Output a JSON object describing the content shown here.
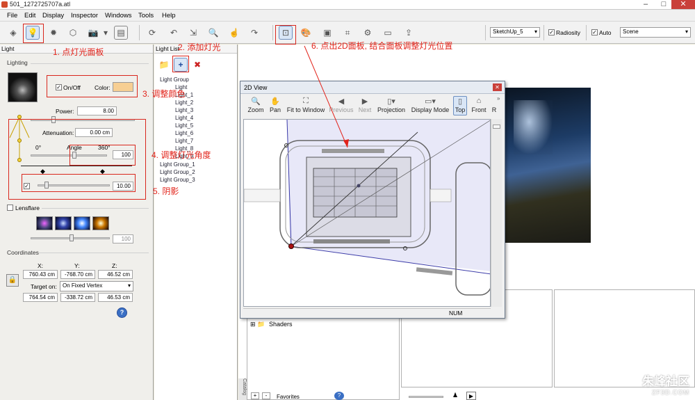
{
  "window": {
    "title": "501_1272725707a.atl"
  },
  "menu": [
    "File",
    "Edit",
    "Display",
    "Inspector",
    "Windows",
    "Tools",
    "Help"
  ],
  "toolbar": {
    "renderer_select": "SketchUp_5",
    "radiosity_label": "Radiosity",
    "auto_label": "Auto",
    "scene_select": "Scene"
  },
  "light_panel": {
    "title": "Light",
    "lighting_label": "Lighting",
    "onoff_label": "On/Off",
    "color_label": "Color:",
    "color_value": "#f7cf93",
    "power_label": "Power:",
    "power_value": "8.00",
    "attenuation_label": "Attenuation:",
    "attenuation_value": "0.00 cm",
    "angle_min": "0°",
    "angle_label": "Angle",
    "angle_max": "360°",
    "angle_value": "100",
    "shadow_value": "10.00",
    "lensflare_label": "Lensflare",
    "lensflare_value": "100",
    "coordinates_label": "Coordinates",
    "x_label": "X:",
    "y_label": "Y:",
    "z_label": "Z:",
    "x_value": "760.43 cm",
    "y_value": "-768.70 cm",
    "z_value": "46.52 cm",
    "target_label": "Target on:",
    "target_value": "On Fixed Vertex",
    "tx_value": "764.54 cm",
    "ty_value": "-338.72 cm",
    "tz_value": "46.53 cm"
  },
  "light_list": {
    "title": "Light List",
    "items": [
      "Light Group",
      "Light",
      "Light_1",
      "Light_2",
      "Light_3",
      "Light_4",
      "Light_5",
      "Light_6",
      "Light_7",
      "Light_8",
      "Light_9",
      "Light Group_1",
      "Light Group_2",
      "Light Group_3"
    ]
  },
  "view2d": {
    "title": "2D View",
    "tools": [
      "Zoom",
      "Pan",
      "Fit to Window",
      "Previous",
      "Next",
      "Projection",
      "Display Mode",
      "Top",
      "Front",
      "R"
    ],
    "status": "NUM"
  },
  "bottom": {
    "shaders_label": "Shaders",
    "favorites_label": "Favorites",
    "catalog_label": "Catalog"
  },
  "annotations": {
    "a1": "1. 点灯光面板",
    "a2": "2. 添加灯光",
    "a3": "3. 调整颜色",
    "a4": "4. 调整灯光角度",
    "a5": "5. 阴影",
    "a6": "6. 点出2D面板, 结合面板调整灯光位置"
  },
  "watermark": "朱峰社区",
  "watermark_sub": "ZF3D.COM",
  "colors": {
    "annotation": "#e2231a",
    "accent": "#d9e6f6"
  }
}
